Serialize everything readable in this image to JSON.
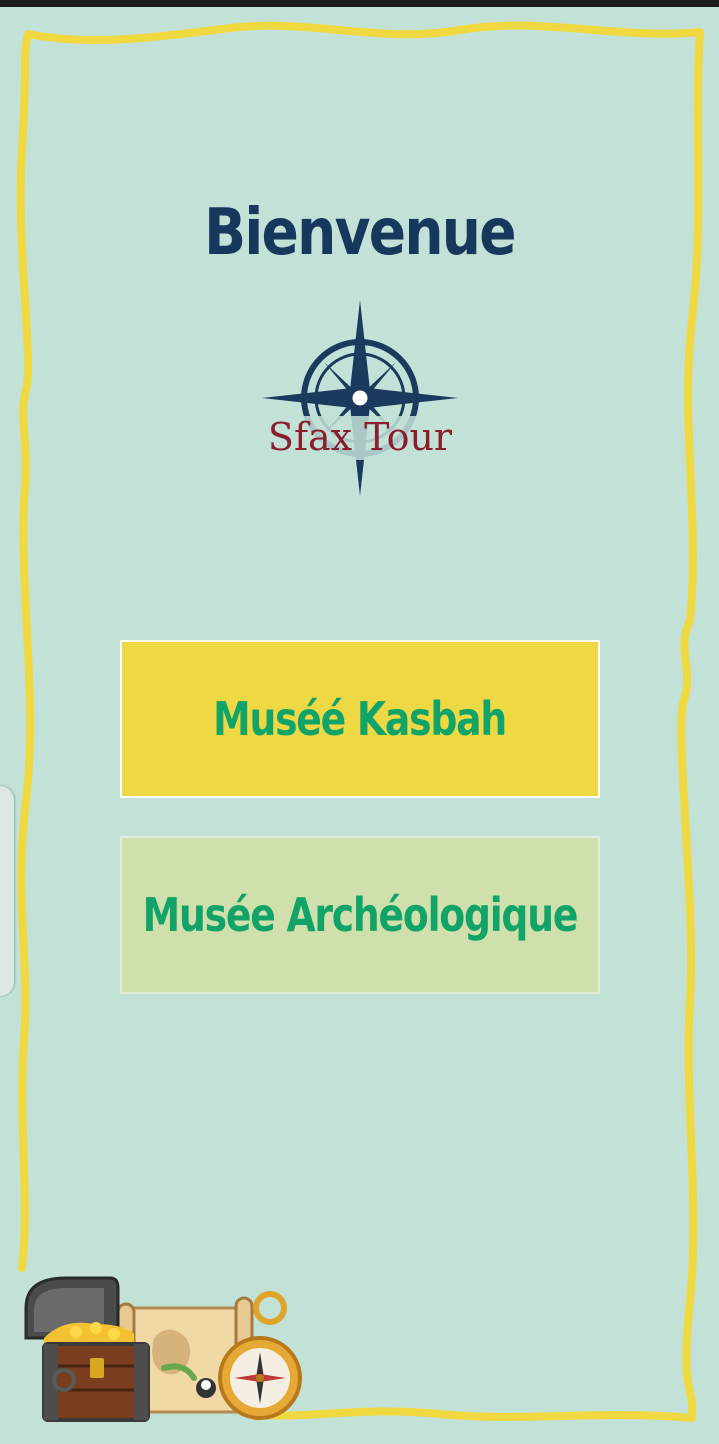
{
  "status_bar": {
    "background": "#1c1c1c"
  },
  "header": {
    "title": "Bienvenue"
  },
  "logo": {
    "brand": "Sfax Tour",
    "icon": "compass-rose-icon"
  },
  "museums": [
    {
      "label": "Muséé Kasbah",
      "background": "#eed944"
    },
    {
      "label": "Musée Archéologique",
      "background": "#cfe0ad"
    }
  ],
  "decoration": {
    "icon": "treasure-chest-map-compass-icon"
  },
  "colors": {
    "background": "#c2e2d8",
    "frame": "#f0d840",
    "title": "#17375c",
    "button_text": "#12a368",
    "logo_text": "#8b1e2e"
  }
}
